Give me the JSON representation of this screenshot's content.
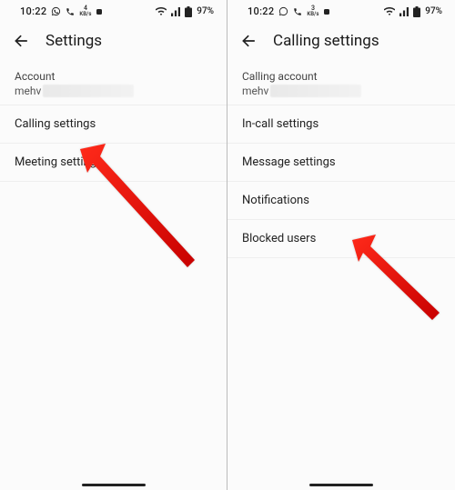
{
  "status": {
    "time": "10:22",
    "net_rate_left_num": "4",
    "net_rate_left_unit": "KB/s",
    "net_rate_right_num": "3",
    "net_rate_right_unit": "KB/s",
    "battery_pct": "97%"
  },
  "screen_left": {
    "title": "Settings",
    "account_label": "Account",
    "account_value_prefix": "mehv",
    "rows": [
      "Calling settings",
      "Meeting settings"
    ]
  },
  "screen_right": {
    "title": "Calling settings",
    "account_label": "Calling account",
    "account_value_prefix": "mehv",
    "rows": [
      "In-call settings",
      "Message settings",
      "Notifications",
      "Blocked users"
    ]
  }
}
